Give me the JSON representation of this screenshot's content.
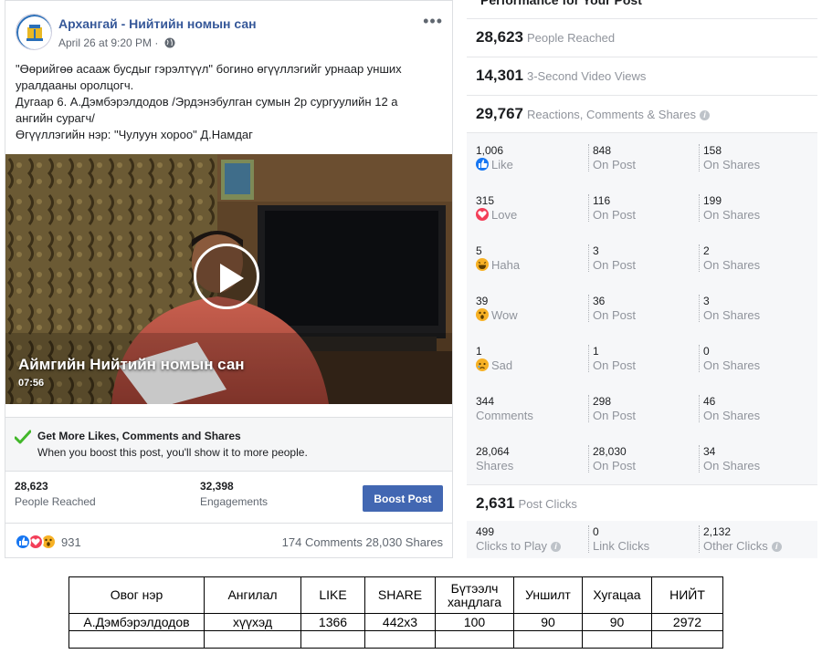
{
  "post": {
    "page_name": "Архангай - Нийтийн номын сан",
    "date": "April 26 at 9:20 PM ·",
    "text_lines": [
      "\"Өөрийгөө асааж бусдыг гэрэлтүүл\" богино өгүүллэгийг урнаар унших",
      "уралдааны оролцогч.",
      "Дугаар 6. А.Дэмбэрэлдодов /Эрдэнэбулган сумын 2р сургуулийн 12 а",
      "ангийн сурагч/",
      "Өгүүллэгийн нэр: \"Чулуун хороо\" Д.Намдаг"
    ],
    "video": {
      "title": "Аймгийн Нийтийн номын сан",
      "duration": "07:56"
    },
    "boost_banner": {
      "title": "Get More Likes, Comments and Shares",
      "subtitle": "When you boost this post, you'll show it to more people."
    },
    "stats": [
      {
        "value": "28,623",
        "label": "People Reached"
      },
      {
        "value": "32,398",
        "label": "Engagements"
      }
    ],
    "boost_button": "Boost Post",
    "reaction_count": "931",
    "comments_shares": "174 Comments  28,030 Shares",
    "icons": [
      "globe-icon",
      "more-icon",
      "play-icon",
      "check-icon",
      "like-icon",
      "love-icon",
      "wow-icon"
    ]
  },
  "performance": {
    "title": "Performance for Your Post",
    "summary": [
      {
        "value": "28,623",
        "label": "People Reached"
      },
      {
        "value": "14,301",
        "label": "3-Second Video Views"
      },
      {
        "value": "29,767",
        "label": "Reactions, Comments & Shares"
      }
    ],
    "breakdown": [
      {
        "name": "like",
        "total": "1,006",
        "label": "Like",
        "on_post": "848",
        "on_shares": "158"
      },
      {
        "name": "love",
        "total": "315",
        "label": "Love",
        "on_post": "116",
        "on_shares": "199"
      },
      {
        "name": "haha",
        "total": "5",
        "label": "Haha",
        "on_post": "3",
        "on_shares": "2"
      },
      {
        "name": "wow",
        "total": "39",
        "label": "Wow",
        "on_post": "36",
        "on_shares": "3"
      },
      {
        "name": "sad",
        "total": "1",
        "label": "Sad",
        "on_post": "1",
        "on_shares": "0"
      },
      {
        "name": "comments",
        "total": "344",
        "label": "Comments",
        "on_post": "298",
        "on_shares": "46"
      },
      {
        "name": "shares",
        "total": "28,064",
        "label": "Shares",
        "on_post": "28,030",
        "on_shares": "34"
      }
    ],
    "on_post_label": "On Post",
    "on_shares_label": "On Shares",
    "post_clicks": {
      "value": "2,631",
      "label": "Post Clicks"
    },
    "clicks": [
      {
        "value": "499",
        "label": "Clicks to Play"
      },
      {
        "value": "0",
        "label": "Link Clicks"
      },
      {
        "value": "2,132",
        "label": "Other Clicks"
      }
    ]
  },
  "table": {
    "headers": [
      "Овог нэр",
      "Ангилал",
      "LIKE",
      "SHARE",
      "Бүтээлч хандлага",
      "Уншилт",
      "Хугацаа",
      "НИЙТ"
    ],
    "rows": [
      [
        "А.Дэмбэрэлдодов",
        "хүүхэд",
        "1366",
        "442x3",
        "100",
        "90",
        "90",
        "2972"
      ],
      [
        "",
        "",
        "",
        "",
        "",
        "",
        "",
        ""
      ]
    ]
  }
}
